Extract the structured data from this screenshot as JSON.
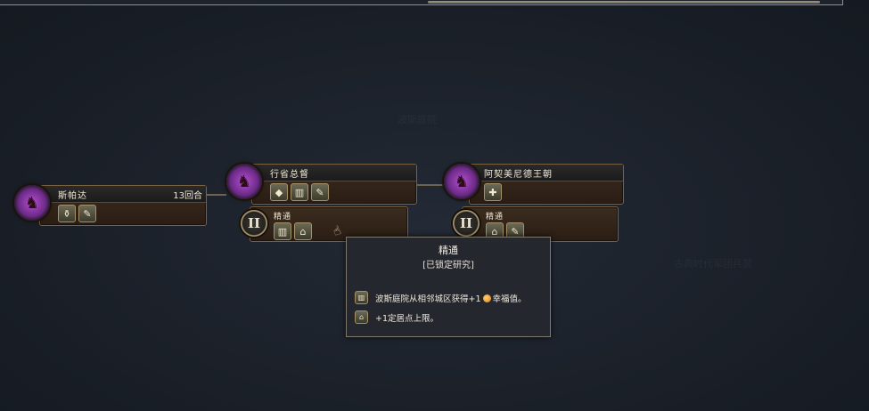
{
  "background_labels": [
    "波斯庭院",
    "古典时代军团兵营"
  ],
  "nodes": [
    {
      "id": "sparta",
      "title": "斯帕达",
      "turns": "13回合",
      "icons": [
        "torch-icon",
        "quill-icon"
      ]
    },
    {
      "id": "governor",
      "title": "行省总督",
      "icons": [
        "diamond-icon",
        "building-icon",
        "quill-icon"
      ]
    },
    {
      "id": "achaemenid",
      "title": "阿契美尼德王朝",
      "icons": [
        "plus-icon"
      ]
    }
  ],
  "masteries": [
    {
      "id": "mastery-1",
      "numeral": "II",
      "title": "精通",
      "icons": [
        "building-icon",
        "settler-icon"
      ]
    },
    {
      "id": "mastery-2",
      "numeral": "II",
      "title": "精通",
      "icons": [
        "settler-icon",
        "quill-icon"
      ]
    }
  ],
  "tooltip": {
    "title": "精通",
    "subtitle": "[已锁定研究]",
    "line1_a": "波斯庭院从相邻城区获得+1",
    "line1_b": "幸福值。",
    "line2": "+1定居点上限。"
  }
}
